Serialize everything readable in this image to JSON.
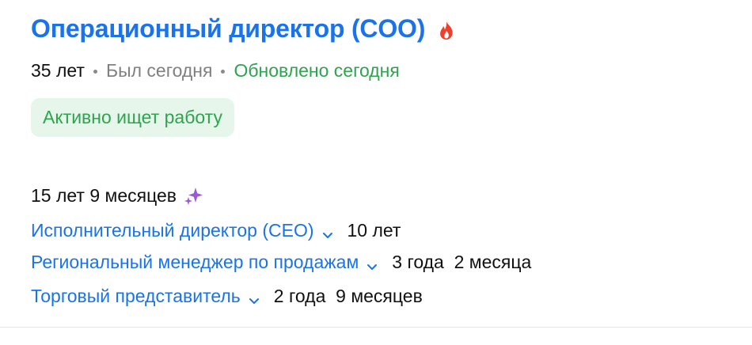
{
  "resume": {
    "title": "Операционный директор (COO)",
    "hot_icon": "fire-icon",
    "hot_icon_color": "#f0402d",
    "age": "35 лет",
    "last_seen": "Был сегодня",
    "updated": "Обновлено сегодня",
    "job_search_status": "Активно ищет работу"
  },
  "experience": {
    "total": "15 лет 9 месяцев",
    "ai_icon": "sparkle-icon",
    "ai_icon_color": "#9b59d6",
    "jobs": [
      {
        "title": "Исполнительный директор (CEO)",
        "duration": "10 лет"
      },
      {
        "title": "Региональный менеджер по продажам",
        "duration": "3 года  2 месяца"
      },
      {
        "title": "Торговый представитель",
        "duration": "2 года  9 месяцев"
      }
    ]
  },
  "colors": {
    "link": "#1a73e8",
    "positive": "#2ea44f",
    "positive_bg": "#e7f6ea",
    "muted": "#808080",
    "text": "#111111"
  }
}
